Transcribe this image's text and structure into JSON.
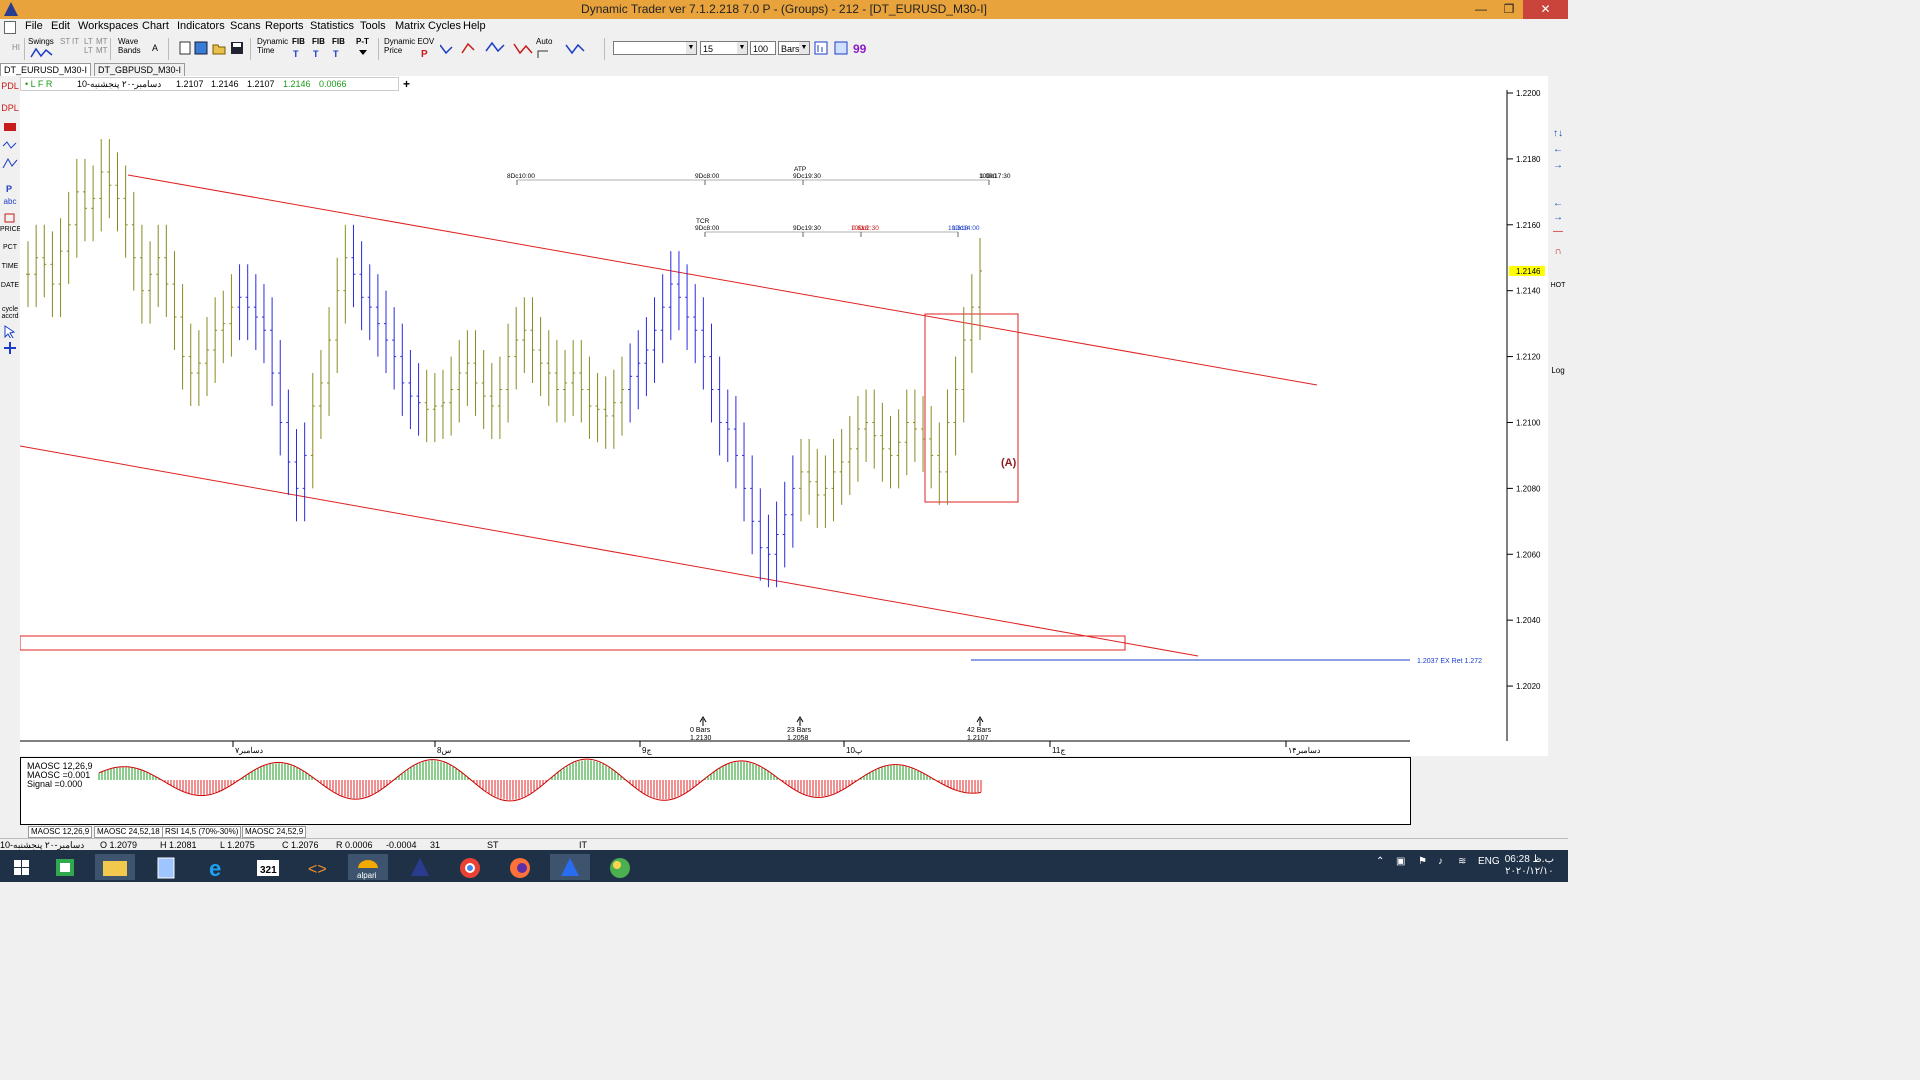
{
  "window": {
    "title": "Dynamic Trader ver 7.1.2.218 7.0 P - (Groups) - 212 - [DT_EURUSD_M30-I]",
    "minimize": "—",
    "restore": "❐",
    "close": "✕"
  },
  "menu": [
    "File",
    "Edit",
    "Workspaces",
    "Chart",
    "Indicators",
    "Scans",
    "Reports",
    "Statistics",
    "Tools",
    "Matrix Cycles",
    "Help"
  ],
  "toolbar": {
    "swings": "Swings",
    "st": "ST",
    "it": "IT",
    "lt": "LT",
    "mt": "MT",
    "wave": "Wave",
    "bands": "Bands",
    "a": "A",
    "dyn_time_1": "Dynamic",
    "dyn_time_2": "Time",
    "fib": "FIB",
    "pt": "P-T",
    "dyn_price_1": "Dynamic EOV",
    "dyn_price_2": "Price",
    "auto": "Auto",
    "combo_blank": "",
    "combo_15": "15",
    "bars_count": "100",
    "bars_unit": "Bars"
  },
  "doc_tabs": [
    "DT_EURUSD_M30-I",
    "DT_GBPUSD_M30-I"
  ],
  "info_bar": {
    "flags": "• L  F  R",
    "date": "10-دسامبر-۲۰ پنجشنبه",
    "o": "1.2107",
    "h": "1.2146",
    "l": "1.2107",
    "c": "1.2146",
    "chg": "0.0066",
    "plus": "+"
  },
  "left_toolbar": [
    "PDL",
    "DPL",
    "PRICE",
    "PCT",
    "TIME",
    "DATE",
    "cycle",
    "accrd",
    "abc"
  ],
  "right_toolbar": {
    "hot": "HOT",
    "log": "Log"
  },
  "colors": {
    "bar_blue": "#2a2ae0",
    "bar_olive": "#8a8a20",
    "channel": "#e02020",
    "osc_up": "#1a9a1a",
    "osc_down": "#e02020",
    "signal": "#cc0000"
  },
  "chart_data": {
    "type": "ohlc",
    "symbol": "DT_EURUSD_M30-I",
    "ylim": [
      1.201,
      1.22
    ],
    "y_ticks": [
      "1.2200",
      "1.2180",
      "1.2160",
      "1.2140",
      "1.2120",
      "1.2100",
      "1.2080",
      "1.2060",
      "1.2040",
      "1.2020"
    ],
    "last_price": "1.2146",
    "x_ticks": [
      "دسامبر۷",
      "8س",
      "9ج",
      "10پ",
      "11ج",
      "دسامبر۱۴"
    ],
    "time_projection_top": {
      "labels": [
        "8Dc10:00",
        "9Dc8:00",
        "9Dc19:30",
        "10Dc17:30"
      ],
      "atp": "ATP",
      "ratio": "1.000"
    },
    "time_projection_mid": {
      "labels": [
        "9Dc8:00",
        "9Dc19:30",
        "10Dc2:30",
        "10Dc14:00"
      ],
      "tcr": "TCR",
      "ratios": [
        "0.618",
        "1.618"
      ]
    },
    "wave_label": "(A)",
    "ex_ret_label": "1.2037 EX Ret 1.272",
    "bar_counts": [
      {
        "bars": "0 Bars",
        "price": "1.2130"
      },
      {
        "bars": "23 Bars",
        "price": "1.2058"
      },
      {
        "bars": "42 Bars",
        "price": "1.2107"
      }
    ],
    "series": [
      {
        "values": [
          1.2145,
          1.215,
          1.2148,
          1.2142,
          1.2152,
          1.216,
          1.217,
          1.2165,
          1.2168,
          1.2176,
          1.2172,
          1.2168,
          1.216,
          1.215,
          1.214,
          1.2145,
          1.215,
          1.2142,
          1.2132,
          1.212,
          1.2115,
          1.2118,
          1.2122,
          1.2128,
          1.213,
          1.2135,
          1.2138,
          1.2135,
          1.2132,
          1.2128,
          1.2115,
          1.21,
          1.2088,
          1.208,
          1.209,
          1.2105,
          1.2112,
          1.2125,
          1.214,
          1.215,
          1.2145,
          1.2138,
          1.2135,
          1.213,
          1.2125,
          1.212,
          1.2112,
          1.2108,
          1.2106,
          1.2104,
          1.2105,
          1.2106,
          1.211,
          1.2115,
          1.2118,
          1.2112,
          1.2108,
          1.2105,
          1.211,
          1.212,
          1.2125,
          1.2128,
          1.2122,
          1.2118,
          1.2115,
          1.211,
          1.2112,
          1.2115,
          1.211,
          1.2105,
          1.2104,
          1.2102,
          1.2106,
          1.211,
          1.2114,
          1.2118,
          1.2122,
          1.2128,
          1.2135,
          1.2142,
          1.2138,
          1.2132,
          1.2128,
          1.212,
          1.211,
          1.21,
          1.2098,
          1.209,
          1.208,
          1.207,
          1.2062,
          1.206,
          1.2066,
          1.2072,
          1.208,
          1.2085,
          1.2082,
          1.2078,
          1.208,
          1.2085,
          1.2088,
          1.2092,
          1.2098,
          1.21,
          1.2096,
          1.2092,
          1.209,
          1.2094,
          1.21,
          1.2098,
          1.2095,
          1.209,
          1.2085,
          1.21,
          1.211,
          1.2125,
          1.2135,
          1.2146
        ]
      }
    ]
  },
  "oscillator": {
    "title": "MAOSC 12,26,9",
    "maosc": "MAOSC =0.001",
    "signal": "Signal =0.000"
  },
  "osc_tabs": [
    "MAOSC 12,26,9",
    "MAOSC 24,52,18",
    "RSI 14,5 (70%-30%)",
    "MAOSC 24,52,9"
  ],
  "status": {
    "date": "10-دسامبر-۲۰ پنجشنبه",
    "o": "O 1.2079",
    "h": "H 1.2081",
    "l": "L 1.2075",
    "c": "C 1.2076",
    "r": "R 0.0006",
    "chg": "-0.0004",
    "num": "31",
    "st": "ST",
    "it": "IT"
  },
  "taskbar": {
    "lang": "ENG",
    "time": "06:28 ب.ظ",
    "date": "۲۰۲۰/۱۲/۱۰",
    "alpari": "alpari"
  }
}
